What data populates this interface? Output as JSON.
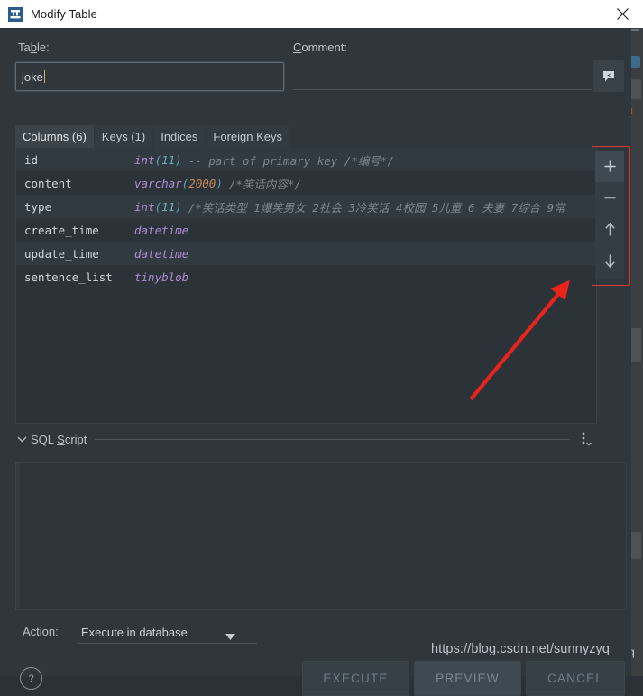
{
  "window": {
    "title": "Modify Table",
    "app_icon": "database-table-icon",
    "close_label": "✕"
  },
  "form": {
    "table_label": "Table:",
    "table_label_accel": "b",
    "table_value": "joke",
    "table_placeholder": "",
    "comment_label": "Comment:",
    "comment_label_accel": "C",
    "comment_value": "",
    "comment_placeholder": "",
    "comment_button_icon": "edit-comment-icon"
  },
  "tabs": [
    {
      "label": "Columns (6)",
      "active": true
    },
    {
      "label": "Keys (1)",
      "active": false
    },
    {
      "label": "Indices",
      "active": false
    },
    {
      "label": "Foreign Keys",
      "active": false
    }
  ],
  "columns": [
    {
      "name": "id",
      "type": "int",
      "length": "11",
      "comment": "-- part of primary key /*编号*/",
      "selected": true
    },
    {
      "name": "content",
      "type": "varchar",
      "length": "2000",
      "comment": "/*笑话内容*/",
      "selected": false
    },
    {
      "name": "type",
      "type": "int",
      "length": "11",
      "comment": "/*笑话类型 1爆笑男女 2社会 3冷笑话 4校园 5儿童 6 夫妻 7综合 9常",
      "selected": true
    },
    {
      "name": "create_time",
      "type": "datetime",
      "length": "",
      "comment": "",
      "selected": false
    },
    {
      "name": "update_time",
      "type": "datetime",
      "length": "",
      "comment": "",
      "selected": true
    },
    {
      "name": "sentence_list",
      "type": "tinyblob",
      "length": "",
      "comment": "",
      "selected": false
    }
  ],
  "side_toolbar": [
    {
      "name": "add-column-button",
      "icon": "plus-icon",
      "label": "+"
    },
    {
      "name": "remove-column-button",
      "icon": "minus-icon",
      "label": "−"
    },
    {
      "name": "move-up-button",
      "icon": "arrow-up-icon",
      "label": "↑"
    },
    {
      "name": "move-down-button",
      "icon": "arrow-down-icon",
      "label": "↓"
    }
  ],
  "sql_script": {
    "title": "SQL Script",
    "title_accel": "S",
    "collapse_icon": "chevron-down-icon",
    "menu_icon": "more-options-icon",
    "content": ""
  },
  "action": {
    "label": "Action:",
    "value": "Execute in database",
    "arrow_icon": "triangle-down-icon"
  },
  "footer": {
    "help_icon": "question-mark-icon",
    "execute_label": "EXECUTE",
    "preview_label": "PREVIEW",
    "cancel_label": "CANCEL"
  },
  "annotations": {
    "arrow_color": "#e03a30",
    "highlight_box_color": "#e03a30",
    "watermark": "https://blog.csdn.net/sunnyzyq"
  },
  "colors": {
    "dialog_bg": "#2f363c",
    "grid_bg": "#2b3238",
    "titlebar_bg": "#ffffff",
    "type_text": "#b08ed4",
    "comment_text": "#7d878d",
    "accent_number": "#c98a56"
  }
}
